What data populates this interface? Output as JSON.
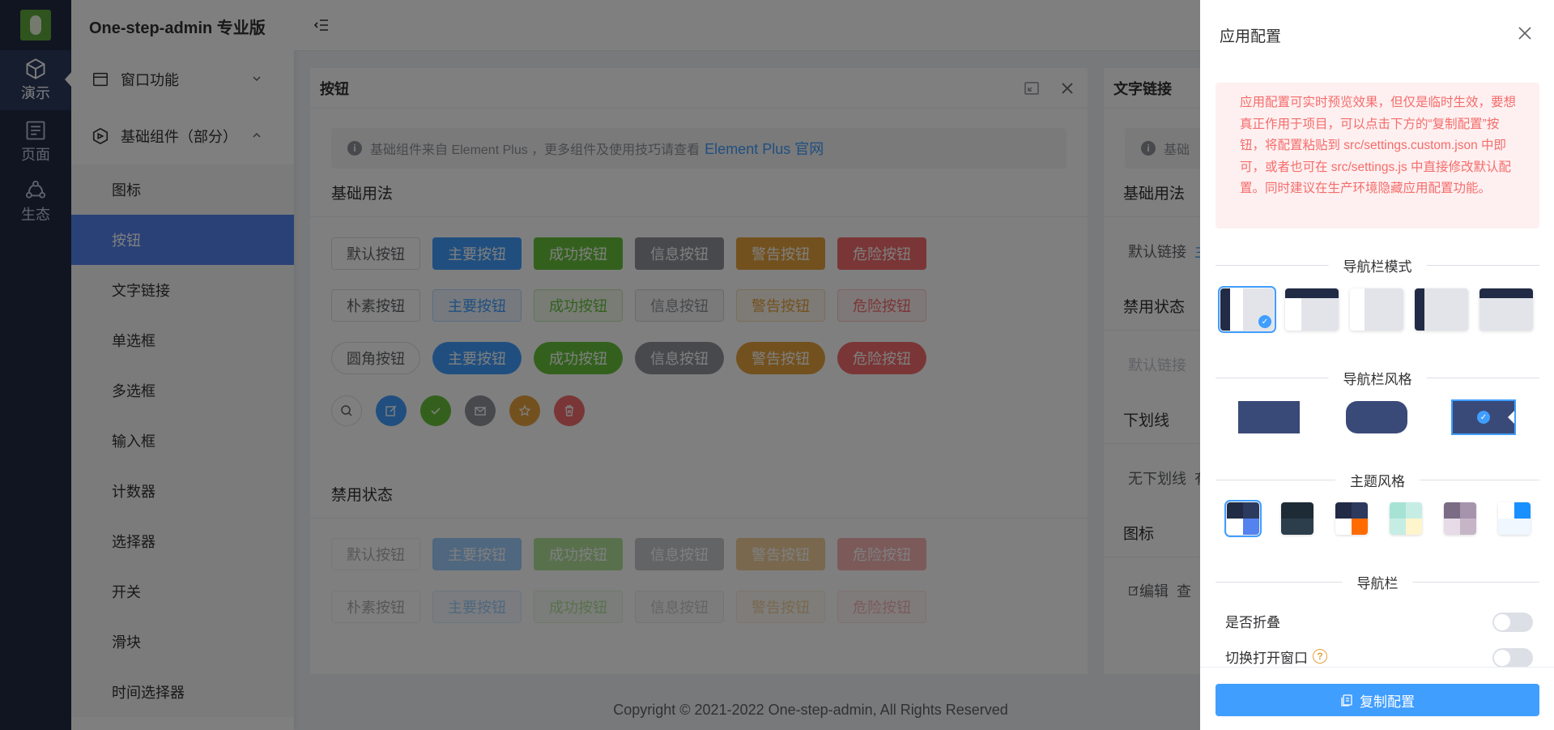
{
  "app": {
    "title": "One-step-admin 专业版"
  },
  "main_sidebar": {
    "items": [
      {
        "label": "演示",
        "icon": "cube-icon"
      },
      {
        "label": "页面",
        "icon": "page-icon"
      },
      {
        "label": "生态",
        "icon": "ecosystem-icon"
      }
    ]
  },
  "sub_sidebar": {
    "group1": "窗口功能",
    "group2": "基础组件（部分）",
    "items": [
      "图标",
      "按钮",
      "文字链接",
      "单选框",
      "多选框",
      "输入框",
      "计数器",
      "选择器",
      "开关",
      "滑块",
      "时间选择器"
    ]
  },
  "card1": {
    "title": "按钮",
    "notice": "基础组件来自 Element Plus ，更多组件及使用技巧请查看",
    "notice_link": "Element Plus 官网",
    "section_basic": "基础用法",
    "section_disabled": "禁用状态",
    "buttons": [
      "默认按钮",
      "主要按钮",
      "成功按钮",
      "信息按钮",
      "警告按钮",
      "危险按钮"
    ],
    "plain_first": "朴素按钮",
    "round_first": "圆角按钮"
  },
  "card2": {
    "title": "文字链接",
    "notice_partial": "基础",
    "section_basic": "基础用法",
    "default_link": "默认链接",
    "link_partial": "主",
    "section_disabled": "禁用状态",
    "disabled_link": "默认链接",
    "section_underline": "下划线",
    "no_underline": "无下划线",
    "no_underline_partial": "有",
    "section_icon": "图标",
    "edit_label": "编辑",
    "view_partial": "查"
  },
  "footer": {
    "text": "Copyright © 2021-2022 One-step-admin, All Rights Reserved"
  },
  "drawer": {
    "title": "应用配置",
    "alert": "应用配置可实时预览效果，但仅是临时生效，要想真正作用于项目，可以点击下方的“复制配置”按钮，将配置粘贴到 src/settings.custom.json 中即可，或者也可在 src/settings.js 中直接修改默认配置。同时建议在生产环境隐藏应用配置功能。",
    "nav_mode": "导航栏模式",
    "nav_style": "导航栏风格",
    "theme_style": "主题风格",
    "navbar": "导航栏",
    "toggle_collapse": "是否折叠",
    "toggle_window": "切换打开窗口",
    "copy_button": "复制配置"
  },
  "colors": {
    "primary": "#409eff",
    "success": "#67c23a",
    "info": "#909399",
    "warning": "#e6a23c",
    "danger": "#f56c6c",
    "sidebar_dark": "#222b45",
    "menu_active": "#5482ee"
  }
}
